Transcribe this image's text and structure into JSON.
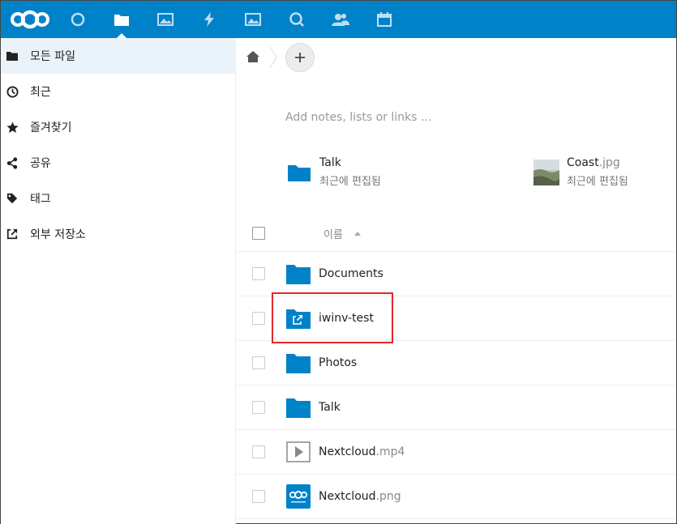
{
  "colors": {
    "brand": "#0082c9",
    "folder": "#0082c9",
    "highlight": "#e3262c"
  },
  "header": {
    "apps": [
      {
        "icon": "dashboard-circle-icon",
        "active": false
      },
      {
        "icon": "files-folder-icon",
        "active": true
      },
      {
        "icon": "photos-image-icon",
        "active": false
      },
      {
        "icon": "activity-bolt-icon",
        "active": false
      },
      {
        "icon": "gallery-image-icon",
        "active": false
      },
      {
        "icon": "talk-search-icon",
        "active": false
      },
      {
        "icon": "contacts-people-icon",
        "active": false
      },
      {
        "icon": "calendar-icon",
        "active": false
      }
    ]
  },
  "sidebar": {
    "items": [
      {
        "label": "모든 파일",
        "icon": "folder-icon"
      },
      {
        "label": "최근",
        "icon": "clock-icon"
      },
      {
        "label": "즐겨찾기",
        "icon": "star-icon"
      },
      {
        "label": "공유",
        "icon": "share-icon"
      },
      {
        "label": "태그",
        "icon": "tag-icon"
      },
      {
        "label": "외부 저장소",
        "icon": "external-link-icon"
      }
    ]
  },
  "main": {
    "notes_placeholder": "Add notes, lists or links …",
    "recent": [
      {
        "name": "Talk",
        "ext": "",
        "sub": "최근에 편집됨"
      },
      {
        "name": "Coast",
        "ext": ".jpg",
        "sub": "최근에 편집됨"
      }
    ],
    "column_name": "이름",
    "files": [
      {
        "name": "Documents",
        "ext": "",
        "type": "folder"
      },
      {
        "name": "iwinv-test",
        "ext": "",
        "type": "external-folder"
      },
      {
        "name": "Photos",
        "ext": "",
        "type": "folder"
      },
      {
        "name": "Talk",
        "ext": "",
        "type": "folder"
      },
      {
        "name": "Nextcloud",
        "ext": ".mp4",
        "type": "video"
      },
      {
        "name": "Nextcloud",
        "ext": ".png",
        "type": "image"
      }
    ]
  }
}
